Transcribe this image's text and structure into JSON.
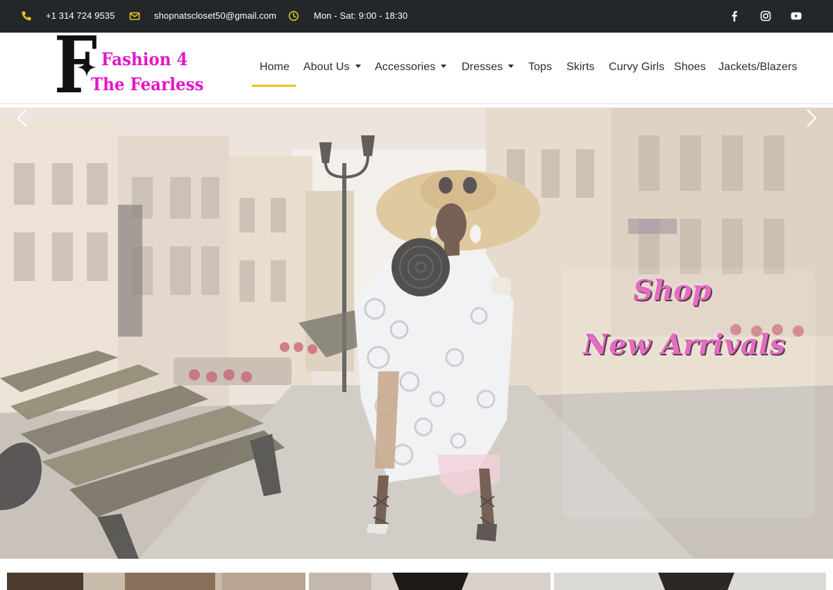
{
  "topbar": {
    "phone": "+1 314 724 9535",
    "email": "shopnatscloset50@gmail.com",
    "hours": "Mon - Sat: 9:00 - 18:30",
    "icon_color": "#e8c31a",
    "icons": [
      "phone-icon",
      "envelope-icon",
      "clock-icon",
      "facebook-icon",
      "instagram-icon",
      "youtube-icon"
    ]
  },
  "logo": {
    "letter": "F",
    "line1": "Fashion 4",
    "line2": "The Fearless",
    "color": "#e317c9"
  },
  "nav": {
    "items": [
      {
        "label": "Home",
        "active": true,
        "dropdown": false
      },
      {
        "label": "About Us",
        "dropdown": true
      },
      {
        "label": "Accessories",
        "dropdown": true
      },
      {
        "label": "Dresses",
        "dropdown": true
      },
      {
        "label": "Tops",
        "dropdown": false
      },
      {
        "label": "Skirts",
        "dropdown": false
      },
      {
        "label": "Curvy Girls",
        "dropdown": false
      },
      {
        "label": "Shoes",
        "dropdown": false
      },
      {
        "label": "Jackets/Blazers",
        "dropdown": false
      }
    ],
    "active_color": "#e8c31a"
  },
  "hero": {
    "line1": "Shop",
    "line2": "New Arrivals",
    "text_color": "#e46cc1",
    "prev_icon": "chevron-left-icon",
    "next_icon": "chevron-right-icon"
  }
}
